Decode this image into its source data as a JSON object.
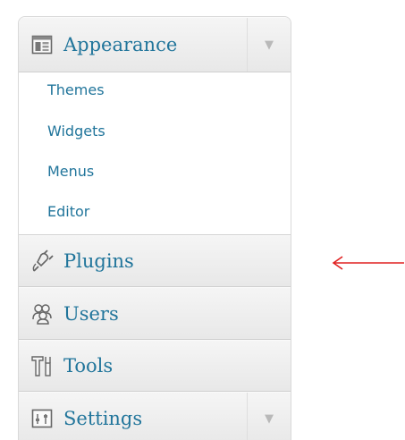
{
  "menu": {
    "appearance": {
      "label": "Appearance",
      "icon": "appearance-icon",
      "toggle_icon": "triangle-down-icon"
    },
    "submenu": {
      "items": [
        {
          "label": "Themes"
        },
        {
          "label": "Widgets"
        },
        {
          "label": "Menus"
        },
        {
          "label": "Editor"
        }
      ]
    },
    "plugins": {
      "label": "Plugins",
      "icon": "plug-icon"
    },
    "users": {
      "label": "Users",
      "icon": "users-icon"
    },
    "tools": {
      "label": "Tools",
      "icon": "tools-icon"
    },
    "settings": {
      "label": "Settings",
      "icon": "settings-icon",
      "toggle_icon": "triangle-down-icon"
    }
  },
  "annotation": {
    "arrow_color": "#e02020",
    "icon": "arrow-left-icon"
  },
  "colors": {
    "link": "#21759b",
    "menu_bg": "#f2f2f2",
    "submenu_bg": "#ffffff"
  }
}
